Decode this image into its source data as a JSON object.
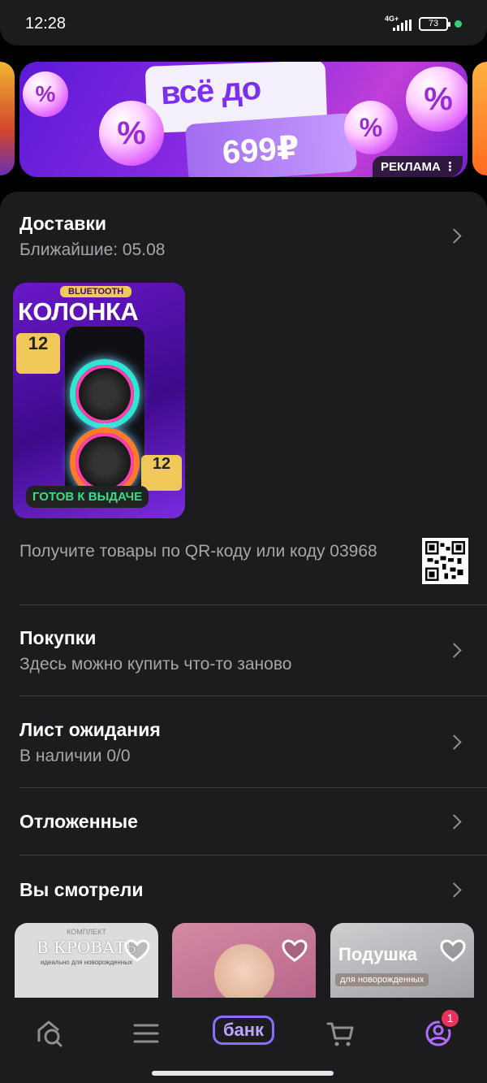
{
  "status_bar": {
    "time": "12:28",
    "network": "4G+",
    "battery": "73"
  },
  "banner": {
    "line1": "всё до",
    "line2": "699₽",
    "ad_label": "РЕКЛАМА ⋮",
    "coin_symbol": "%"
  },
  "deliveries": {
    "title": "Доставки",
    "subtitle": "Ближайшие: 05.08",
    "product": {
      "bluetooth": "BLUETOOTH",
      "title": "КОЛОНКА",
      "warranty": "12",
      "hours": "12",
      "status": "ГОТОВ К ВЫДАЧЕ"
    },
    "qr_text": "Получите товары по QR-коду или коду 03968"
  },
  "purchases": {
    "title": "Покупки",
    "subtitle": "Здесь можно купить что-то заново"
  },
  "waitlist": {
    "title": "Лист ожидания",
    "subtitle": "В наличии 0/0"
  },
  "saved": {
    "title": "Отложенные"
  },
  "viewed": {
    "title": "Вы смотрели",
    "items": [
      {
        "caption": "В КРОВАТЬ",
        "top_small": "КОМПЛЕКТ",
        "small": "идеально для новорожденных"
      },
      {
        "caption": ""
      },
      {
        "caption": "Подушка",
        "sub": "для новорожденных"
      }
    ]
  },
  "bottom_nav": {
    "bank_label": "банк",
    "profile_badge": "1"
  },
  "colors": {
    "accent": "#8b6cff",
    "ready_green": "#3ddc84",
    "badge_red": "#e6335a"
  }
}
